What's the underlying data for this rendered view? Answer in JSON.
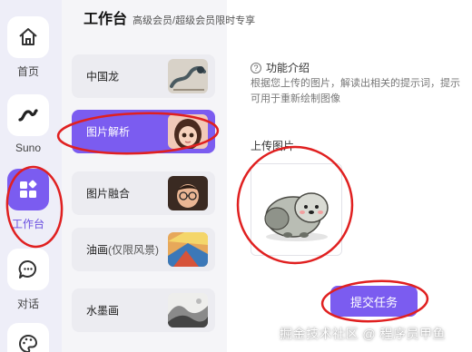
{
  "header": {
    "title": "工作台",
    "subtitle": "高级会员/超级会员限时专享"
  },
  "nav": {
    "items": [
      {
        "label": "首页",
        "icon": "home-icon",
        "active": false
      },
      {
        "label": "Suno",
        "icon": "suno-wave-icon",
        "active": false
      },
      {
        "label": "工作台",
        "icon": "grid-icon",
        "active": true
      },
      {
        "label": "对话",
        "icon": "chat-icon",
        "active": false
      },
      {
        "label": "",
        "icon": "palette-icon",
        "active": false
      }
    ]
  },
  "features": [
    {
      "label": "中国龙",
      "thumb": "dragon-thumbnail",
      "active": false
    },
    {
      "label": "图片解析",
      "thumb": "girl-portrait-thumbnail",
      "active": true
    },
    {
      "label": "图片融合",
      "thumb": "boy-portrait-thumbnail",
      "active": false
    },
    {
      "label": "油画",
      "label_suffix": "(仅限风景)",
      "thumb": "oil-painting-thumbnail",
      "active": false
    },
    {
      "label": "水墨画",
      "thumb": "ink-painting-thumbnail",
      "active": false
    }
  ],
  "panel": {
    "section_title": "功能介绍",
    "description": "根据您上传的图片，解读出相关的提示词，提示\n可用于重新绘制图像",
    "upload_label": "上传图片",
    "uploaded_image": "fluffy-animal-illustration",
    "submit_label": "提交任务"
  },
  "watermark": "掘金技术社区 @ 程序员甲鱼",
  "colors": {
    "accent": "#7b5cf0",
    "annotation": "#e02020",
    "sidebar_bg": "#eeeef8"
  }
}
